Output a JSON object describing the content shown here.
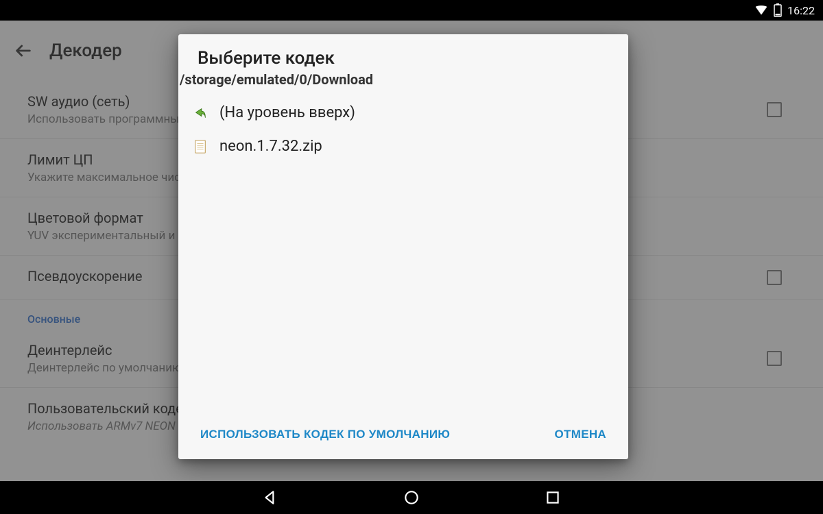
{
  "status": {
    "time": "16:22"
  },
  "page": {
    "title": "Декодер",
    "prefs": [
      {
        "title": "SW аудио (сеть)",
        "sub": "Использовать программный декодер",
        "checkbox": true
      },
      {
        "title": "Лимит ЦП",
        "sub": "Укажите максимальное число",
        "checkbox": false
      },
      {
        "title": "Цветовой формат",
        "sub": "YUV экспериментальный и",
        "checkbox": false
      },
      {
        "title": "Псевдоускорение",
        "sub": "",
        "checkbox": true
      }
    ],
    "section": "Основные",
    "prefs2": [
      {
        "title": "Деинтерлейс",
        "sub": "Деинтерлейс по умолчанию",
        "checkbox": true
      },
      {
        "title": "Пользовательский кодек",
        "sub": "Использовать ARMv7 NEON",
        "checkbox": false
      }
    ]
  },
  "dialog": {
    "title": "Выберите кодек",
    "path": "/storage/emulated/0/Download",
    "up_label": "(На уровень вверх)",
    "files": [
      {
        "name": "neon.1.7.32.zip"
      }
    ],
    "default_btn": "ИСПОЛЬЗОВАТЬ КОДЕК ПО УМОЛЧАНИЮ",
    "cancel_btn": "ОТМЕНА"
  }
}
